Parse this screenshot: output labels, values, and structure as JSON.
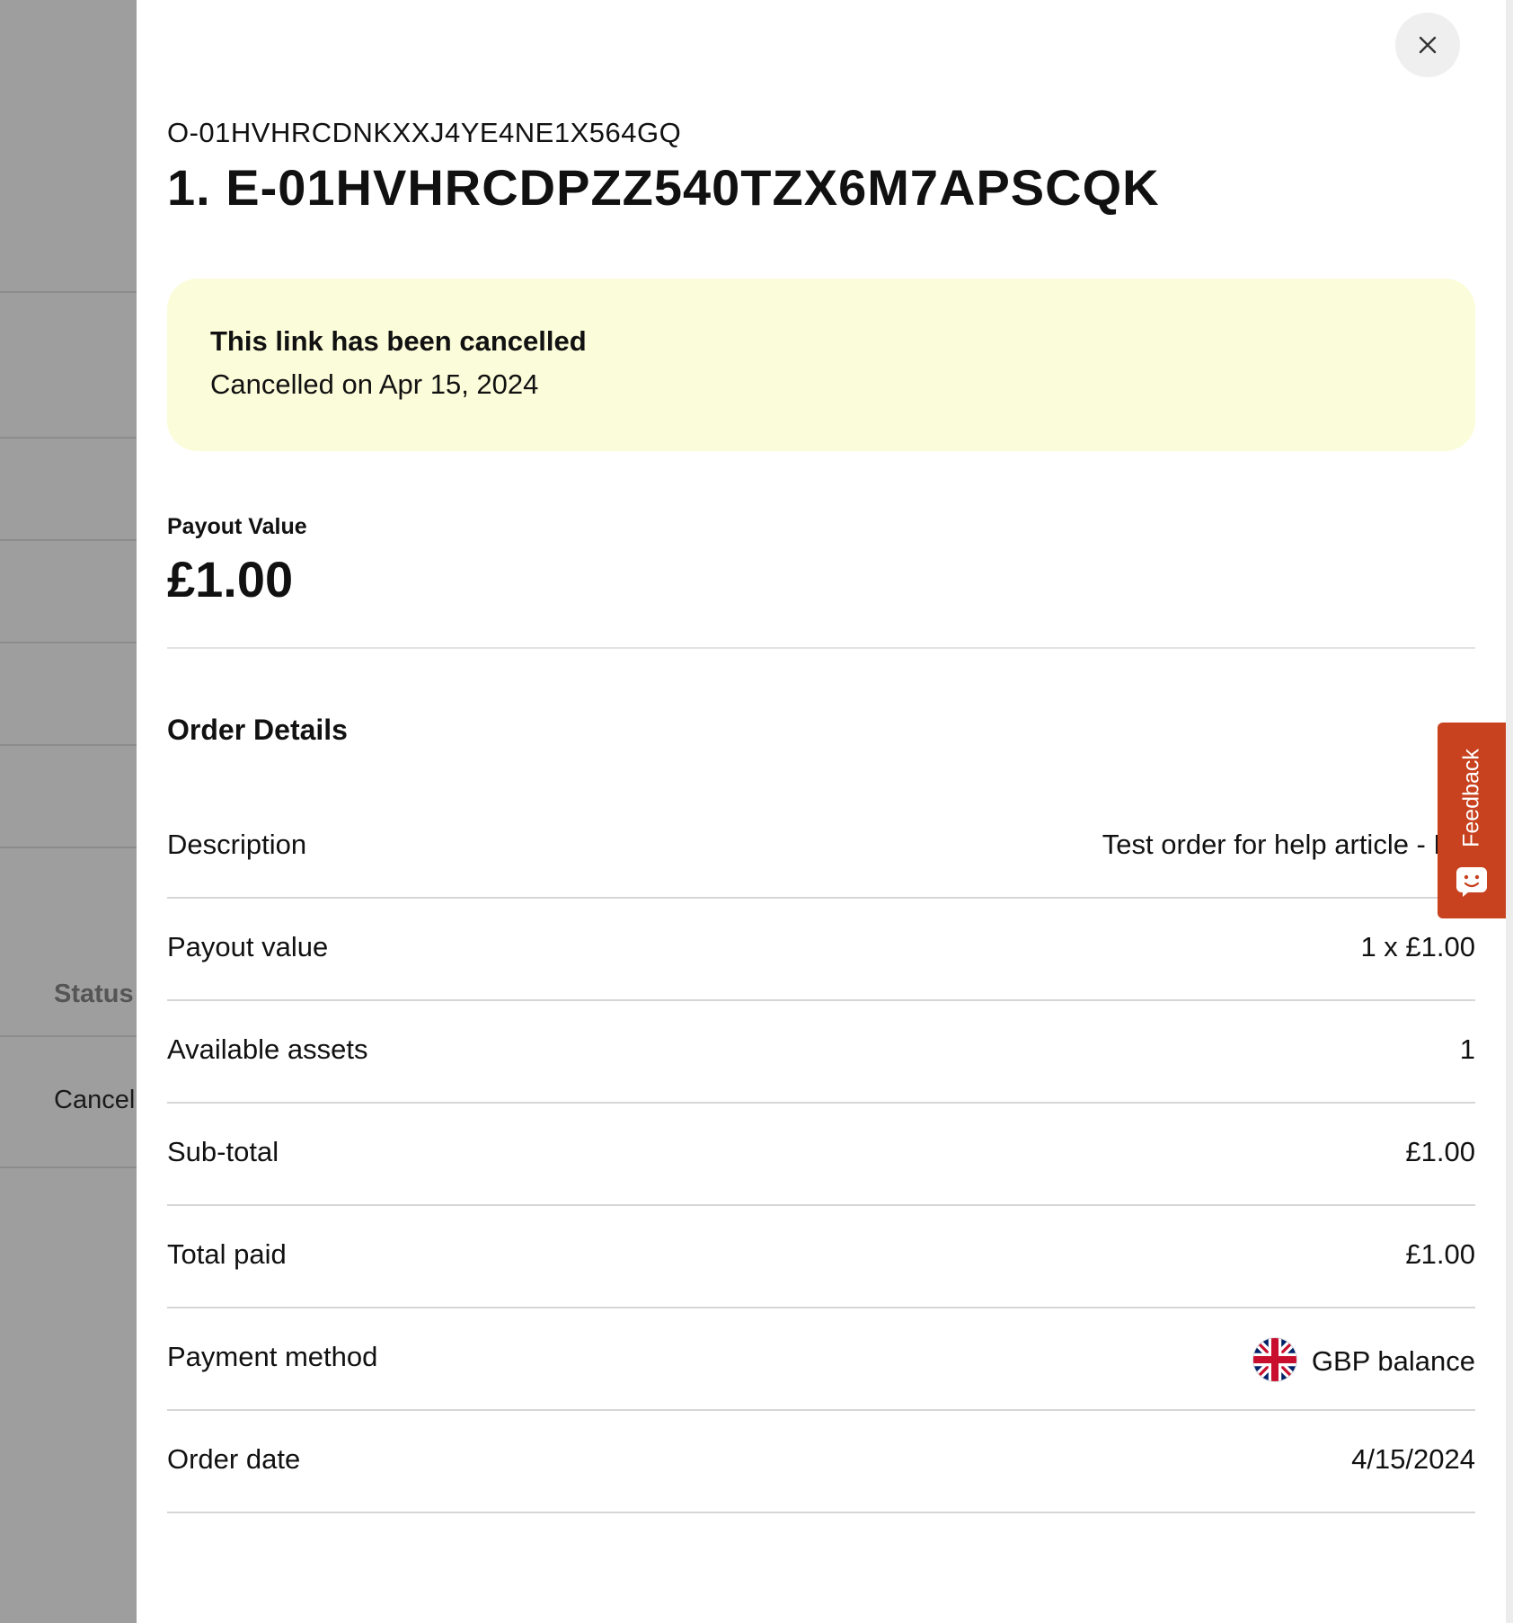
{
  "backdrop": {
    "status_header": "Status",
    "status_cell": "Cancel"
  },
  "drawer": {
    "close_icon": "close-icon",
    "order_id": "O-01HVHRCDNKXXJ4YE4NE1X564GQ",
    "entitlement_title": "1. E-01HVHRCDPZZ540TZX6M7APSCQK",
    "notice": {
      "title": "This link has been cancelled",
      "subtitle": "Cancelled on Apr 15, 2024",
      "background": "#fbfcd9"
    },
    "payout": {
      "label": "Payout Value",
      "amount": "£1.00"
    },
    "order_details": {
      "title": "Order Details",
      "rows": [
        {
          "label": "Description",
          "value": "Test order for help article - MA"
        },
        {
          "label": "Payout value",
          "value": "1 x £1.00"
        },
        {
          "label": "Available assets",
          "value": "1"
        },
        {
          "label": "Sub-total",
          "value": "£1.00"
        },
        {
          "label": "Total paid",
          "value": "£1.00"
        },
        {
          "label": "Payment method",
          "value": "GBP balance",
          "icon": "uk-flag-icon"
        },
        {
          "label": "Order date",
          "value": "4/15/2024"
        }
      ]
    }
  },
  "feedback": {
    "label": "Feedback",
    "icon": "chat-smile-icon",
    "color": "#c8421f"
  }
}
